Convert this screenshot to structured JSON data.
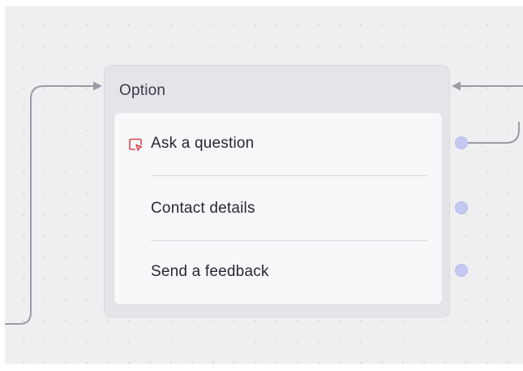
{
  "node": {
    "title": "Option",
    "options": [
      {
        "label": "Ask a question",
        "icon": "message-pointer-icon"
      },
      {
        "label": "Contact details"
      },
      {
        "label": "Send a feedback"
      }
    ]
  },
  "colors": {
    "canvas": "#efeff1",
    "node_frame": "#e4e4e9",
    "card": "#f7f8fa",
    "handle": "#c5c8f0",
    "connector": "#9a9ca6",
    "icon_accent": "#e0454f"
  }
}
